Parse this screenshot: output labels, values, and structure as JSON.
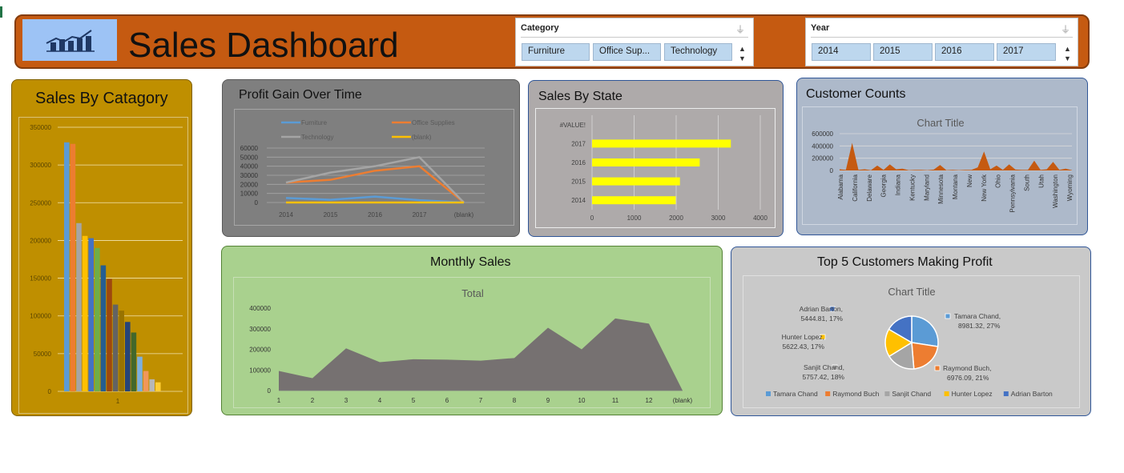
{
  "header": {
    "title": "Sales Dashboard",
    "logo_icon": "bar-line-chart-icon",
    "bg_color": "#c55a11"
  },
  "category_slicer": {
    "title": "Category",
    "items": [
      "Furniture",
      "Office Sup...",
      "Technology"
    ]
  },
  "year_slicer": {
    "title": "Year",
    "items": [
      "2014",
      "2015",
      "2016",
      "2017"
    ]
  },
  "panels": {
    "sales_by_category": "Sales By Catagory",
    "profit_gain": "Profit Gain  Over Time",
    "sales_by_state": "Sales By State",
    "customer_counts": "Customer Counts",
    "monthly_sales": "Monthly Sales",
    "top5": "Top 5 Customers Making Profit"
  },
  "chart_data": [
    {
      "id": "sales_by_category",
      "type": "bar",
      "categories": [
        "1"
      ],
      "ylim": [
        0,
        350000
      ],
      "yticks": [
        "0",
        "50000",
        "100000",
        "150000",
        "200000",
        "250000",
        "300000",
        "350000"
      ],
      "values": [
        330000,
        328000,
        223000,
        206000,
        203000,
        190000,
        167000,
        149000,
        115000,
        107000,
        92000,
        78000,
        46000,
        27000,
        16000,
        12000
      ],
      "colors": [
        "#5b9bd5",
        "#ed7d31",
        "#a5a5a5",
        "#ffc000",
        "#4472c4",
        "#70ad47",
        "#255e91",
        "#9e480e",
        "#636363",
        "#997300",
        "#264478",
        "#43682b",
        "#7cafdd",
        "#f1975a",
        "#b7b7b7",
        "#ffcd33"
      ]
    },
    {
      "id": "profit_gain",
      "type": "line",
      "categories": [
        "2014",
        "2015",
        "2016",
        "2017",
        "(blank)"
      ],
      "yticks": [
        "0",
        "10000",
        "20000",
        "30000",
        "40000",
        "50000",
        "60000"
      ],
      "ylim": [
        0,
        60000
      ],
      "series": [
        {
          "name": "Furniture",
          "color": "#5b9bd5",
          "values": [
            5000,
            3000,
            6500,
            2500,
            0
          ]
        },
        {
          "name": "Office Supplies",
          "color": "#ed7d31",
          "values": [
            22000,
            25000,
            35000,
            40000,
            0
          ]
        },
        {
          "name": "Technology",
          "color": "#a5a5a5",
          "values": [
            22000,
            33000,
            40000,
            50000,
            0
          ]
        },
        {
          "name": "(blank)",
          "color": "#ffc000",
          "values": [
            0,
            0,
            0,
            0,
            0
          ]
        }
      ]
    },
    {
      "id": "sales_by_state",
      "type": "bar",
      "orientation": "horizontal",
      "categories": [
        "#VALUE!",
        "2017",
        "2016",
        "2015",
        "2014"
      ],
      "values": [
        0,
        3300,
        2560,
        2090,
        1990
      ],
      "xticks": [
        "0",
        "1000",
        "2000",
        "3000",
        "4000"
      ],
      "xlim": [
        0,
        4000
      ],
      "color": "#ffff00"
    },
    {
      "id": "customer_counts",
      "type": "area",
      "title": "Chart Title",
      "yticks": [
        "0",
        "200000",
        "400000",
        "600000"
      ],
      "ylim": [
        0,
        600000
      ],
      "xlabels": [
        "Alabama",
        "California",
        "Delaware",
        "Georgia",
        "Indiana",
        "Kentucky",
        "Maryland",
        "Minnesota",
        "Montana",
        "New",
        "New York",
        "Ohio",
        "Pennsylvania",
        "South",
        "Utah",
        "Washington",
        "Wyoming"
      ],
      "values": [
        20000,
        10000,
        450000,
        10000,
        20000,
        5000,
        80000,
        10000,
        100000,
        20000,
        30000,
        5000,
        10000,
        10000,
        5000,
        15000,
        90000,
        5000,
        10000,
        5000,
        10000,
        10000,
        50000,
        310000,
        20000,
        80000,
        10000,
        100000,
        15000,
        10000,
        10000,
        160000,
        10000,
        20000,
        140000,
        10000,
        30000,
        5000
      ],
      "color": "#c55a11"
    },
    {
      "id": "monthly_sales",
      "type": "area",
      "title": "Total",
      "categories": [
        "1",
        "2",
        "3",
        "4",
        "5",
        "6",
        "7",
        "8",
        "9",
        "10",
        "11",
        "12",
        "(blank)"
      ],
      "values": [
        95000,
        60000,
        205000,
        138000,
        152000,
        150000,
        145000,
        158000,
        305000,
        200000,
        350000,
        325000,
        0
      ],
      "yticks": [
        "0",
        "100000",
        "200000",
        "300000",
        "400000"
      ],
      "ylim": [
        0,
        400000
      ],
      "color": "#767171"
    },
    {
      "id": "top5",
      "type": "pie",
      "title": "Chart Title",
      "slices": [
        {
          "name": "Tamara Chand",
          "value": 8981.32,
          "pct": "27%",
          "label": "Tamara Chand,",
          "label2": "8981.32, 27%",
          "color": "#5b9bd5"
        },
        {
          "name": "Raymond Buch",
          "value": 6976.09,
          "pct": "21%",
          "label": "Raymond Buch,",
          "label2": "6976.09, 21%",
          "color": "#ed7d31"
        },
        {
          "name": "Sanjit Chand",
          "value": 5757.42,
          "pct": "18%",
          "label": "Sanjit Chand,",
          "label2": "5757.42, 18%",
          "color": "#a5a5a5"
        },
        {
          "name": "Hunter Lopez",
          "value": 5622.43,
          "pct": "17%",
          "label": "Hunter Lopez,",
          "label2": "5622.43, 17%",
          "color": "#ffc000"
        },
        {
          "name": "Adrian Barton",
          "value": 5444.81,
          "pct": "17%",
          "label": "Adrian Barton,",
          "label2": "5444.81, 17%",
          "color": "#4472c4"
        }
      ]
    }
  ]
}
